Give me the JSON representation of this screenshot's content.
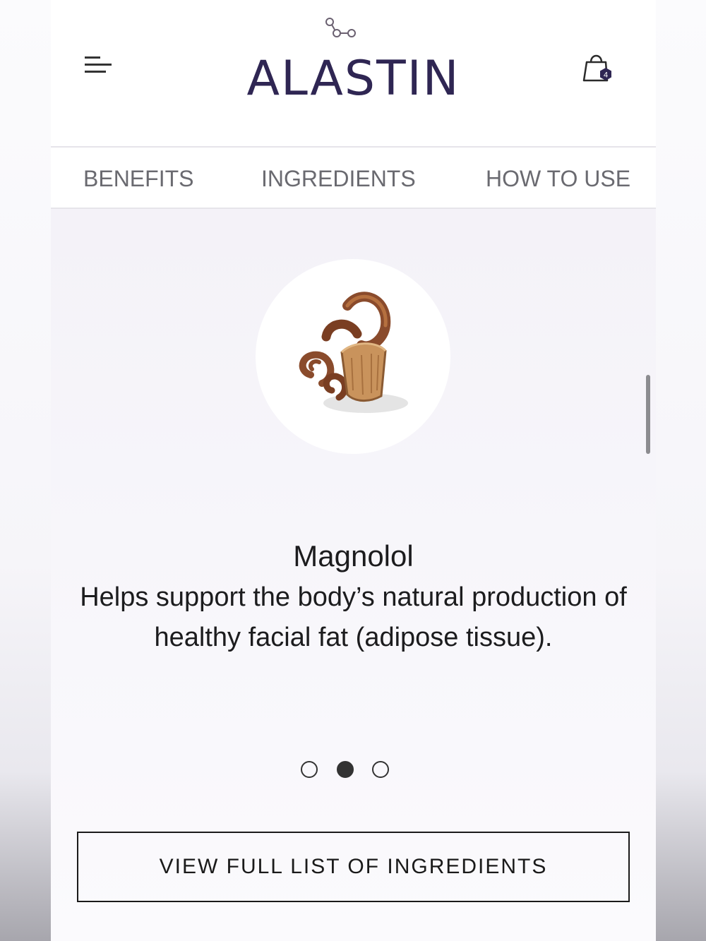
{
  "header": {
    "brand": "ALASTIN",
    "cart_count": "4",
    "brand_color": "#2f2653"
  },
  "tabs": [
    {
      "label": "BENEFITS"
    },
    {
      "label": "INGREDIENTS"
    },
    {
      "label": "HOW TO USE"
    }
  ],
  "ingredient": {
    "name": "Magnolol",
    "description": "Helps support the body’s natural production of healthy facial fat (adipose tissue).",
    "icon": "magnolia-bark-image"
  },
  "carousel": {
    "total": 3,
    "active_index": 2
  },
  "cta": {
    "label": "VIEW FULL LIST OF INGREDIENTS"
  }
}
